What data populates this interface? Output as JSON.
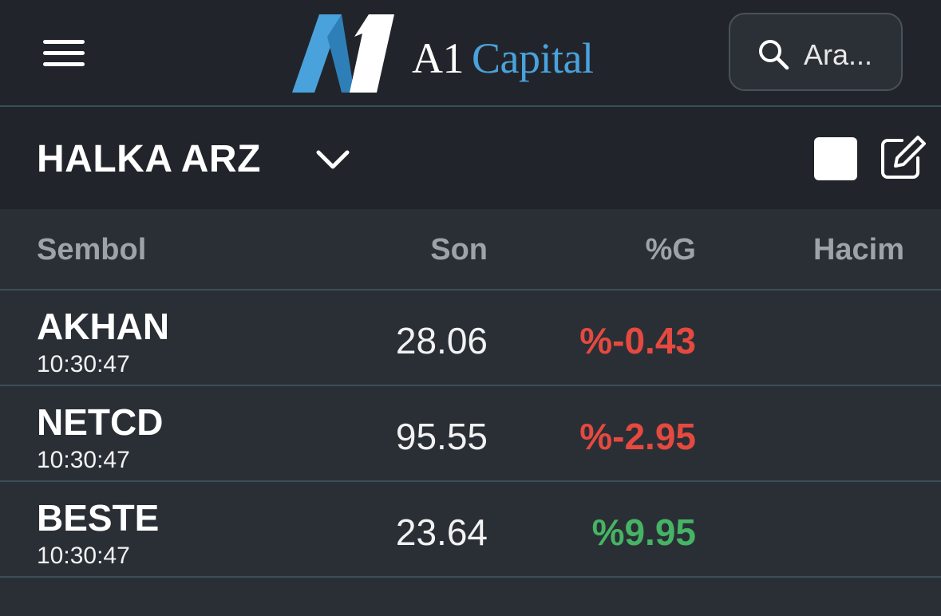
{
  "header": {
    "logo": {
      "prefix": "A1",
      "suffix": "Capital"
    },
    "search": {
      "placeholder": "Ara..."
    }
  },
  "watchlist": {
    "title": "HALKA ARZ"
  },
  "table": {
    "columns": [
      "Sembol",
      "Son",
      "%G",
      "Hacim"
    ],
    "rows": [
      {
        "symbol": "AKHAN",
        "time": "10:30:47",
        "last": "28.06",
        "change": "%-0.43",
        "volume": ""
      },
      {
        "symbol": "NETCD",
        "time": "10:30:47",
        "last": "95.55",
        "change": "%-2.95",
        "volume": ""
      },
      {
        "symbol": "BESTE",
        "time": "10:30:47",
        "last": "23.64",
        "change": "%9.95",
        "volume": ""
      }
    ]
  },
  "colors": {
    "negative": "#e5493f",
    "positive": "#46b464",
    "brand_blue": "#4aa2dc"
  },
  "icons": [
    "hamburger-menu-icon",
    "search-icon",
    "chevron-down-icon",
    "square-icon",
    "edit-icon"
  ]
}
